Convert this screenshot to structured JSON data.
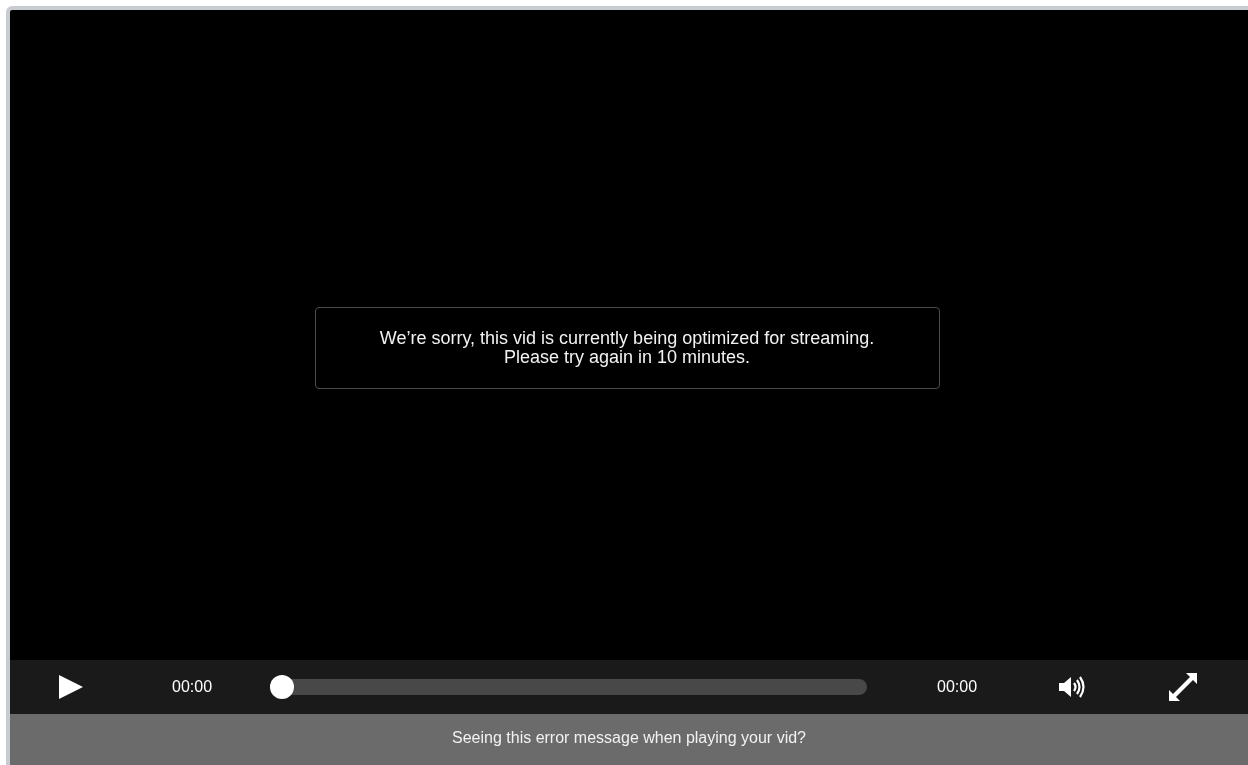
{
  "player": {
    "message": "We’re sorry, this vid is currently being optimized for streaming. Please try again in 10 minutes.",
    "controls": {
      "current_time": "00:00",
      "seek": {
        "level": 0
      },
      "duration": "00:00"
    }
  },
  "caption": "Seeing this error message when playing your vid?"
}
